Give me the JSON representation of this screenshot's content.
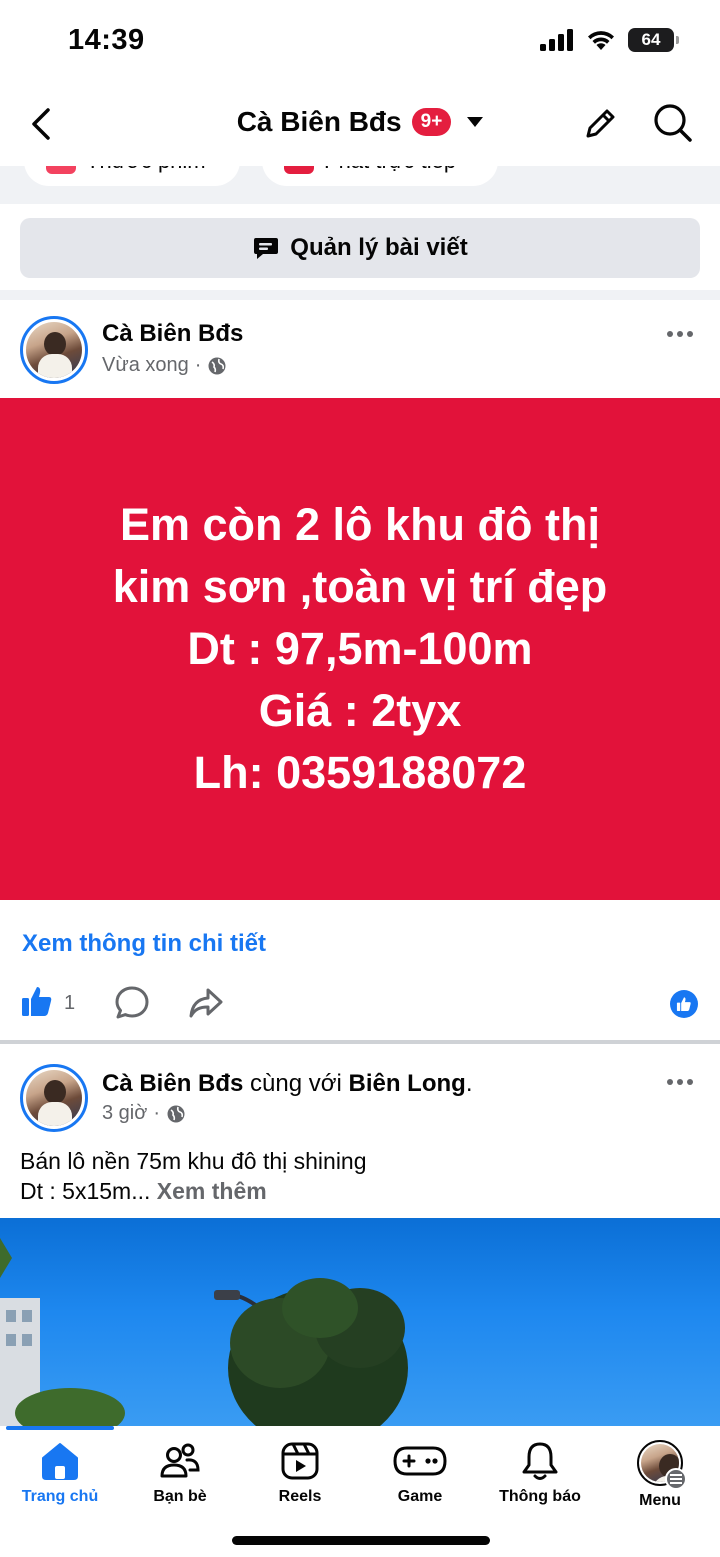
{
  "status_bar": {
    "time": "14:39",
    "battery": "64"
  },
  "header": {
    "title": "Cà Biên Bđs",
    "badge": "9+"
  },
  "peek_pills": {
    "left": "Thước phim",
    "right": "Phát trực tiếp"
  },
  "manage_button": {
    "label": "Quản lý bài viết"
  },
  "post1": {
    "author": "Cà Biên Bđs",
    "time": "Vừa xong",
    "card_lines": [
      "Em còn 2 lô khu đô thị",
      "kim sơn ,toàn vị trí đẹp",
      "Dt : 97,5m-100m",
      "Giá : 2tyx",
      "Lh: 0359188072"
    ],
    "card_color": "#e2123a",
    "detail_link": "Xem thông tin chi tiết",
    "like_count": "1"
  },
  "post2": {
    "author": "Cà Biên Bđs",
    "with_text": "cùng với",
    "tagged": "Biên Long",
    "period": ".",
    "time": "3 giờ",
    "line1": "Bán lô nền 75m khu đô thị shining",
    "line2": "Dt : 5x15m...",
    "see_more": "Xem thêm"
  },
  "bottom_nav": [
    {
      "label": "Trang chủ",
      "icon": "home-icon",
      "active": true
    },
    {
      "label": "Bạn bè",
      "icon": "friends-icon",
      "active": false
    },
    {
      "label": "Reels",
      "icon": "reels-icon",
      "active": false
    },
    {
      "label": "Game",
      "icon": "gamepad-icon",
      "active": false
    },
    {
      "label": "Thông báo",
      "icon": "bell-icon",
      "active": false
    },
    {
      "label": "Menu",
      "icon": "menu-avatar",
      "active": false
    }
  ],
  "colors": {
    "accent": "#1877f2",
    "badge": "#e41e3f",
    "secondary_text": "#65676b"
  }
}
